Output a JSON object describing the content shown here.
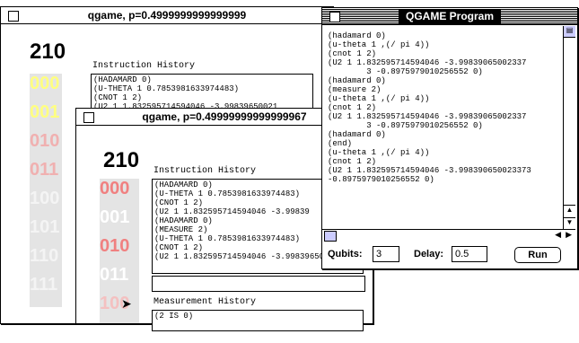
{
  "window1": {
    "title": "qgame, p=0.4999999999999999",
    "big_number": "210",
    "instruction_history_label": "Instruction History",
    "history": "(HADAMARD 0)\n(U-THETA 1 0.7853981633974483)\n(CNOT 1 2)\n(U2 1 1.832595714594046 -3.99839650021",
    "states": [
      "000",
      "001",
      "010",
      "011",
      "100",
      "101",
      "110",
      "111"
    ],
    "state_colors": [
      "#ffff80",
      "#ffff80",
      "#f0b0b0",
      "#f0b0b0",
      "#f4f4f4",
      "#f4f4f4",
      "#f4f4f4",
      "#f4f4f4"
    ]
  },
  "window2": {
    "title": "qgame, p=0.49999999999999967",
    "big_number": "210",
    "instruction_history_label": "Instruction History",
    "history": "(HADAMARD 0)\n(U-THETA 1 0.7853981633974483)\n(CNOT 1 2)\n(U2 1 1.832595714594046 -3.99839\n(HADAMARD 0)\n(MEASURE 2)\n(U-THETA 1 0.7853981633974483)\n(CNOT 1 2)\n(U2 1 1.832595714594046 -3.99839650023",
    "measurement_history_label": "Measurement History",
    "measurement": "(2 IS 0)",
    "states": [
      "000",
      "001",
      "010",
      "011",
      "100",
      "101"
    ],
    "state_colors": [
      "#f08080",
      "#ffffff",
      "#f08080",
      "#ffffff",
      "#f4c0c0",
      "#ffffff"
    ]
  },
  "program_window": {
    "title": "QGAME Program",
    "code": "(hadamard 0)\n(u-theta 1 ,(/ pi 4))\n(cnot 1 2)\n(U2 1 1.832595714594046 -3.99839065002337\n        3 -0.8975979010256552 0)\n(hadamard 0)\n(measure 2)\n(u-theta 1 ,(/ pi 4))\n(cnot 1 2)\n(U2 1 1.832595714594046 -3.99839065002337\n        3 -0.8975979010256552 0)\n(hadamard 0)\n(end)\n(u-theta 1 ,(/ pi 4))\n(cnot 1 2)\n(U2 1 1.832595714594046 -3.998390650023373\n-0.8975979010256552 0)",
    "qubits_label": "Qubits:",
    "qubits_value": "3",
    "delay_label": "Delay:",
    "delay_value": "0.5",
    "run_label": "Run"
  }
}
